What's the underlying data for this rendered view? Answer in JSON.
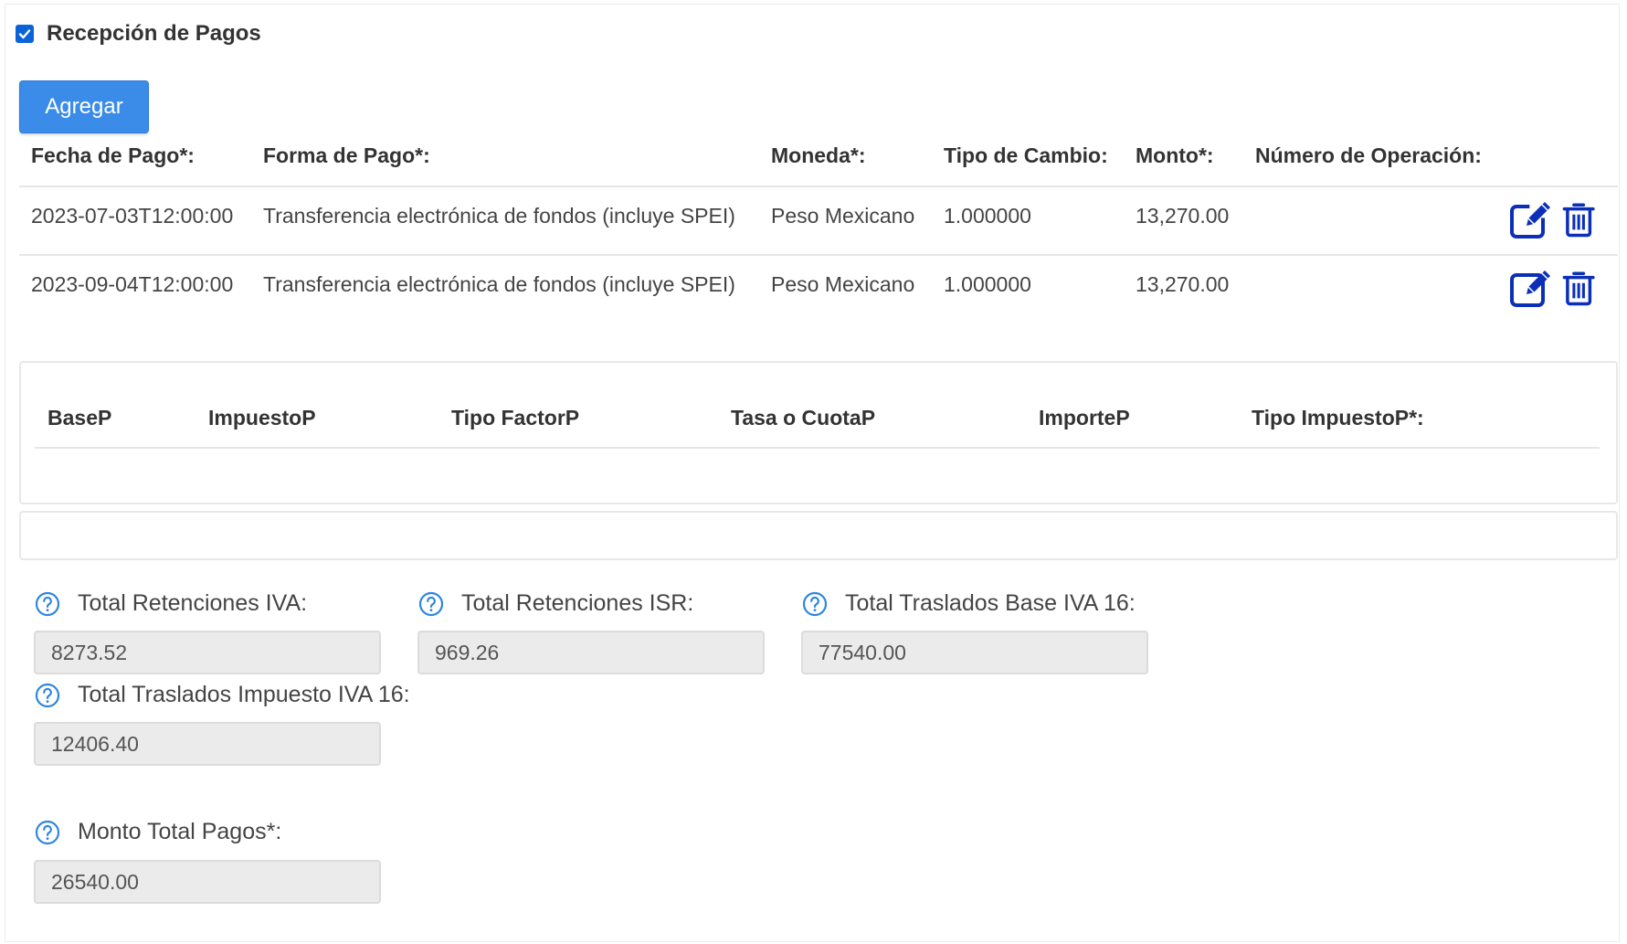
{
  "section": {
    "checked": true,
    "title": "Recepción de Pagos"
  },
  "toolbar": {
    "add_label": "Agregar"
  },
  "payments_table": {
    "headers": {
      "fecha": "Fecha de Pago*:",
      "forma": "Forma de Pago*:",
      "moneda": "Moneda*:",
      "tipo_cambio": "Tipo de Cambio:",
      "monto": "Monto*:",
      "numero_operacion": "Número de Operación:"
    },
    "rows": [
      {
        "fecha": "2023-07-03T12:00:00",
        "forma": "Transferencia electrónica de fondos (incluye SPEI)",
        "moneda": "Peso Mexicano",
        "tipo_cambio": "1.000000",
        "monto": "13,270.00",
        "numero_operacion": ""
      },
      {
        "fecha": "2023-09-04T12:00:00",
        "forma": "Transferencia electrónica de fondos (incluye SPEI)",
        "moneda": "Peso Mexicano",
        "tipo_cambio": "1.000000",
        "monto": "13,270.00",
        "numero_operacion": ""
      }
    ],
    "row_actions": [
      "edit-icon",
      "trash-icon"
    ]
  },
  "taxes_table": {
    "headers": {
      "base": "BaseP",
      "impuesto": "ImpuestoP",
      "tipo_factor": "Tipo FactorP",
      "tasa_cuota": "Tasa o CuotaP",
      "importe": "ImporteP",
      "tipo_impuesto": "Tipo ImpuestoP*:"
    },
    "rows": []
  },
  "totals": {
    "ret_iva": {
      "label": "Total Retenciones IVA:",
      "value": "8273.52"
    },
    "ret_isr": {
      "label": "Total Retenciones ISR:",
      "value": "969.26"
    },
    "tras_base_iva16": {
      "label": "Total Traslados Base IVA 16:",
      "value": "77540.00"
    },
    "tras_imp_iva16": {
      "label": "Total Traslados Impuesto IVA 16:",
      "value": "12406.40"
    },
    "monto_total": {
      "label": "Monto Total Pagos*:",
      "value": "26540.00"
    }
  },
  "icons": {
    "help": "question-circle-icon",
    "edit": "edit-icon",
    "delete": "trash-icon"
  },
  "colors": {
    "primary": "#3a8ce8",
    "checkbox": "#0b63d8",
    "action_icon": "#0c2fb8",
    "help_icon": "#2e86de",
    "readonly_bg": "#ebebeb"
  }
}
